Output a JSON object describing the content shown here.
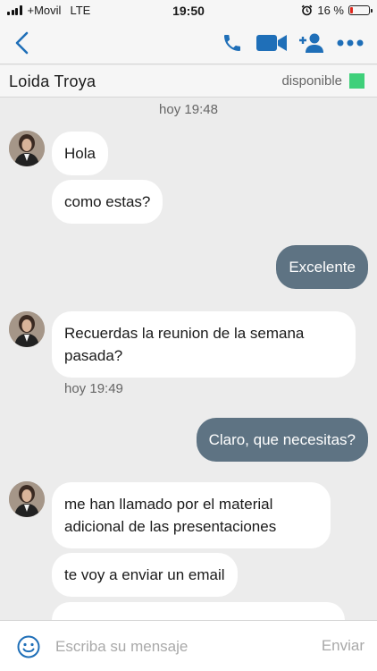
{
  "status_bar": {
    "carrier": "+Movil",
    "network": "LTE",
    "time": "19:50",
    "battery_percent": "16 %",
    "battery_level": 0.16
  },
  "header": {
    "back_icon": "chevron-left-icon",
    "actions": [
      "phone-icon",
      "video-icon",
      "add-contact-icon",
      "more-icon"
    ],
    "accent_color": "#1f6fb8"
  },
  "contact": {
    "name": "Loida Troya",
    "presence": "disponible",
    "presence_color": "#3fd07a"
  },
  "conversation": {
    "first_timestamp": "hoy 19:48",
    "second_timestamp": "hoy 19:49",
    "messages": [
      {
        "from": "them",
        "text": "Hola"
      },
      {
        "from": "them",
        "text": "como estas?"
      },
      {
        "from": "me",
        "text": "Excelente"
      },
      {
        "from": "them",
        "text": "Recuerdas la reunion de la semana pasada?"
      },
      {
        "from": "me",
        "text": "Claro, que necesitas?"
      },
      {
        "from": "them",
        "text": "me han llamado por el material adicional de las presentaciones"
      },
      {
        "from": "them",
        "text": "te voy a enviar un email"
      }
    ],
    "incoming_color": "#ffffff",
    "outgoing_color": "#5e7383"
  },
  "composer": {
    "placeholder": "Escriba su mensaje",
    "send_label": "Enviar",
    "emoji_icon": "smiley-icon"
  }
}
